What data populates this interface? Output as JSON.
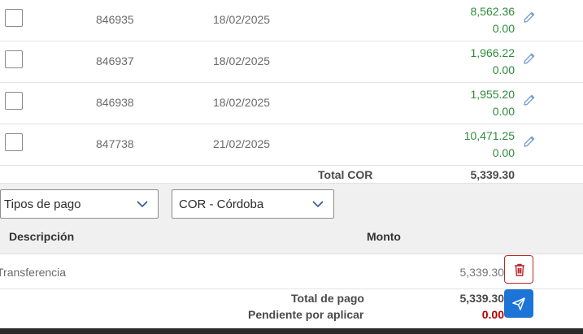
{
  "invoices": [
    {
      "number": "846935",
      "date": "18/02/2025",
      "amount": "8,562.36",
      "applied": "0.00"
    },
    {
      "number": "846937",
      "date": "18/02/2025",
      "amount": "1,966.22",
      "applied": "0.00"
    },
    {
      "number": "846938",
      "date": "18/02/2025",
      "amount": "1,955.20",
      "applied": "0.00"
    },
    {
      "number": "847738",
      "date": "21/02/2025",
      "amount": "10,471.25",
      "applied": "0.00"
    }
  ],
  "total": {
    "label": "Total COR",
    "value": "5,339.30"
  },
  "filters": {
    "payment_type": {
      "value": "Tipos de pago"
    },
    "currency": {
      "value": "COR - Córdoba"
    }
  },
  "payments_table": {
    "headers": {
      "description": "Descripción",
      "amount": "Monto"
    },
    "rows": [
      {
        "description": "Transferencia",
        "amount": "5,339.30"
      }
    ]
  },
  "summary": {
    "total_label": "Total de pago",
    "total_value": "5,339.30",
    "pending_label": "Pendiente por aplicar",
    "pending_value": "0.00"
  },
  "icons": {
    "edit": "pencil-icon",
    "delete": "trash-icon",
    "send": "send-icon",
    "dropdown": "chevron-down-icon"
  },
  "colors": {
    "amount_green": "#2e8b3a",
    "pending_red": "#b00000",
    "delete_red": "#b8262b",
    "send_blue": "#1b74d6"
  }
}
